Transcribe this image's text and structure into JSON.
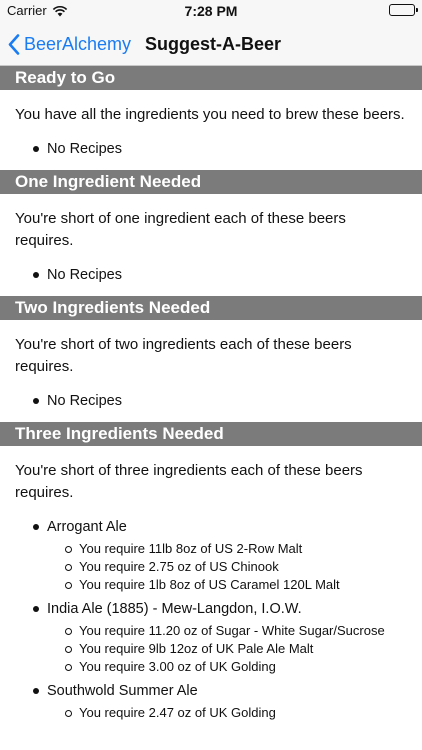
{
  "status_bar": {
    "carrier": "Carrier",
    "time": "7:28 PM"
  },
  "nav": {
    "back_label": "BeerAlchemy",
    "title": "Suggest-A-Beer",
    "accent_color": "#1a7cf3"
  },
  "sections": [
    {
      "title": "Ready to Go",
      "description": "You have all the ingredients you need to brew these beers.",
      "recipes": [
        {
          "name": "No Recipes",
          "requirements": []
        }
      ]
    },
    {
      "title": "One Ingredient Needed",
      "description": "You're short of one ingredient each of these beers requires.",
      "recipes": [
        {
          "name": "No Recipes",
          "requirements": []
        }
      ]
    },
    {
      "title": "Two Ingredients Needed",
      "description": "You're short of two ingredients each of these beers requires.",
      "recipes": [
        {
          "name": "No Recipes",
          "requirements": []
        }
      ]
    },
    {
      "title": "Three Ingredients Needed",
      "description": "You're short of three ingredients each of these beers requires.",
      "recipes": [
        {
          "name": "Arrogant Ale",
          "requirements": [
            "You require 11lb 8oz of US 2-Row Malt",
            "You require 2.75 oz of US Chinook",
            "You require 1lb 8oz of US Caramel 120L Malt"
          ]
        },
        {
          "name": "India Ale (1885) - Mew-Langdon, I.O.W.",
          "requirements": [
            "You require 11.20 oz of Sugar - White Sugar/Sucrose",
            "You require 9lb 12oz of UK Pale Ale Malt",
            "You require 3.00 oz of UK Golding"
          ]
        },
        {
          "name": "Southwold Summer Ale",
          "requirements": [
            "You require 2.47 oz of UK Golding"
          ]
        }
      ]
    }
  ]
}
